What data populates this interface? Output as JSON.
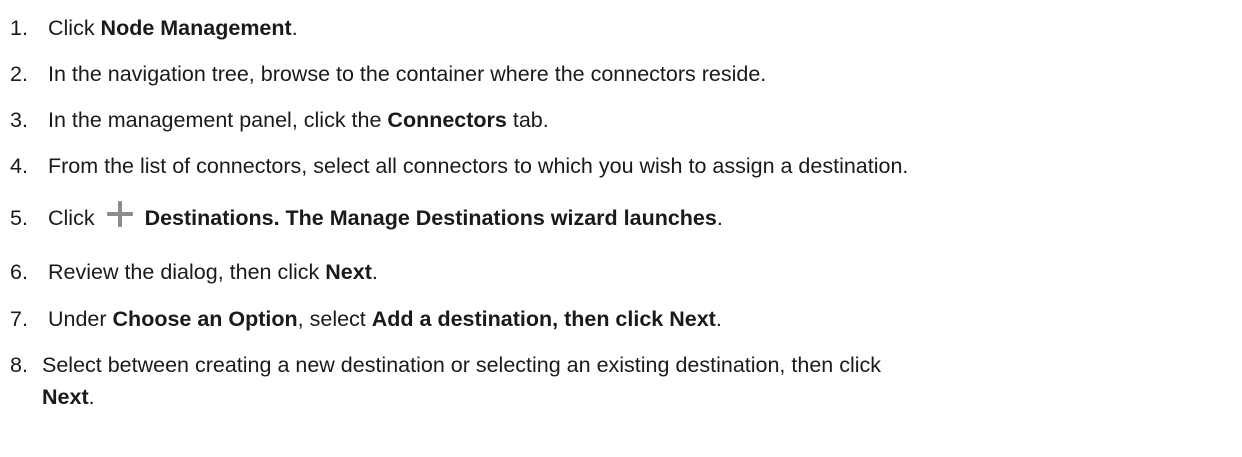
{
  "steps": [
    {
      "number": "1.",
      "parts": [
        "Click ",
        "Node Management",
        "."
      ]
    },
    {
      "number": "2.",
      "text": "In the navigation tree, browse to the container where the connectors reside."
    },
    {
      "number": "3.",
      "parts": [
        "In the management panel, click the ",
        "Connectors",
        " tab."
      ]
    },
    {
      "number": "4.",
      "text": "From the list of connectors, select all connectors to which you wish to assign a destination."
    },
    {
      "number": "5.",
      "icon": "plus-icon",
      "parts": [
        "Click",
        "Destinations. The Manage Destinations wizard launches",
        "."
      ]
    },
    {
      "number": "6.",
      "parts": [
        "Review the dialog, then click ",
        "Next",
        "."
      ]
    },
    {
      "number": "7.",
      "parts": [
        "Under ",
        "Choose an Option",
        ", select ",
        "Add a destination, then click Next",
        "."
      ]
    },
    {
      "number": "8.",
      "parts": [
        "Select between creating a new destination or selecting an existing destination, then click",
        "Next",
        "."
      ]
    }
  ]
}
